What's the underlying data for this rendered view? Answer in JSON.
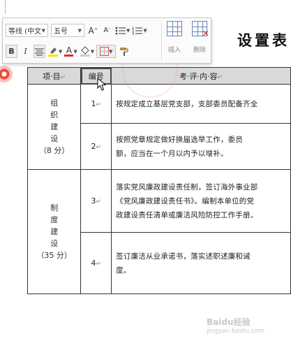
{
  "document": {
    "title": "设置表"
  },
  "toolbar": {
    "font_name": "等线 (中文",
    "font_size": "五号",
    "grow_font": "A",
    "shrink_font": "A",
    "bold": "B",
    "italic": "I",
    "font_color": "A",
    "insert_label": "插入",
    "delete_label": "删除"
  },
  "table": {
    "headers": [
      "项·目",
      "编号",
      "考·评·内·容"
    ],
    "groups": [
      {
        "item_lines": [
          "组",
          "织",
          "建",
          "设",
          "（8 分）"
        ],
        "rows": [
          {
            "num": "1",
            "lines": [
              "按规定成立基层党支部，支部委员配备齐全"
            ]
          },
          {
            "num": "2",
            "lines": [
              "按照党章规定做好换届选举工作，委员",
              "额，应当在一个月以内予以增补。"
            ]
          }
        ]
      },
      {
        "item_lines": [
          "制",
          "度",
          "建",
          "设",
          "（35 分）"
        ],
        "rows": [
          {
            "num": "3",
            "lines": [
              "落实党风廉政建设责任制，签订海外事业部",
              "《党风廉政建设责任书》。编制本单位的党",
              "政建设责任清单或廉洁风险防控工作手册。"
            ]
          },
          {
            "num": "4",
            "lines": [
              "签订廉洁从业承诺书，落实述职述廉和诫",
              "度。"
            ]
          }
        ]
      }
    ]
  },
  "watermark": {
    "text": "Baidu经验",
    "sub": "jingyan.baidu.com"
  }
}
